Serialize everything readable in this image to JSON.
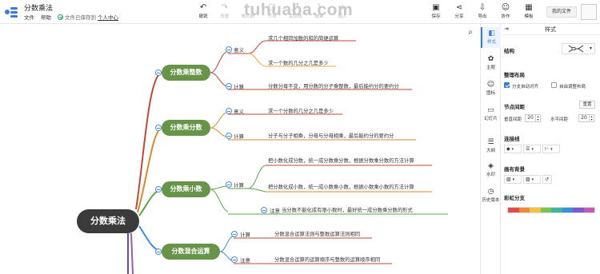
{
  "app": {
    "doc_title": "分数乘法",
    "menu": [
      "文件",
      "帮助"
    ],
    "save_status": "文件已保存到",
    "save_location": "个人中心",
    "watermark": "tuhuaba.com"
  },
  "toolbar": {
    "left": [
      {
        "label": "撤销",
        "icon": "undo-icon",
        "enabled": true
      },
      {
        "label": "恢复",
        "icon": "redo-icon",
        "enabled": false
      },
      {
        "label": "格式刷",
        "icon": "format-brush-icon",
        "enabled": false
      },
      {
        "label": "节点",
        "icon": "node-icon",
        "enabled": false
      },
      {
        "label": "关系线",
        "icon": "relation-line-icon",
        "enabled": false
      },
      {
        "label": "概要",
        "icon": "summary-icon",
        "enabled": false
      },
      {
        "label": "插入",
        "icon": "insert-icon",
        "enabled": false
      }
    ],
    "right": [
      {
        "label": "保存",
        "icon": "save-icon"
      },
      {
        "label": "分享",
        "icon": "share-icon"
      },
      {
        "label": "导出",
        "icon": "export-icon"
      },
      {
        "label": "协作",
        "icon": "collab-icon"
      },
      {
        "label": "模板",
        "icon": "template-icon"
      }
    ],
    "my_files": "我的文件"
  },
  "mindmap": {
    "root": "分数乘法",
    "branches": [
      {
        "label": "分数乘整数",
        "items": [
          {
            "label": "意义",
            "leaves": [
              "求几个相同加数的和的简便运算",
              "求一个数的几分之几是多少"
            ]
          },
          {
            "label": "计算",
            "leaves": [
              "分数分母不变，用分数的分子乘整数，最后能约分的要约分"
            ]
          }
        ]
      },
      {
        "label": "分数乘分数",
        "items": [
          {
            "label": "意义",
            "leaves": [
              "求一个分数的几分之几是多少"
            ]
          },
          {
            "label": "计算",
            "leaves": [
              "分子与分子相乘，分母与分母相乘，最后能约分的要约分"
            ]
          }
        ]
      },
      {
        "label": "分数乘小数",
        "items": [
          {
            "label": "计算",
            "leaves": [
              "把小数化成分数，统一成分数乘分数，根据分数乘分数的方法计算",
              "把分数化成小数，统一成小数乘小数，根据小数乘小数的方法计算"
            ]
          },
          {
            "label": "注意",
            "leaves": [
              "当分数不能化成有限小数时，最好统一成分数乘分数的形式"
            ]
          }
        ]
      },
      {
        "label": "分数混合运算",
        "items": [
          {
            "label": "计算",
            "leaves": [
              "分数混合运算法则与整数运算法则相同"
            ]
          },
          {
            "label": "注意",
            "leaves": [
              "分数混合运算的运算顺序与整数的运算顺序相同"
            ]
          }
        ]
      }
    ]
  },
  "sidebar_tabs": [
    {
      "label": "样式",
      "icon": "style-icon",
      "active": true
    },
    {
      "label": "主题",
      "icon": "theme-icon",
      "active": false
    },
    {
      "label": "图标",
      "icon": "icon-library-icon",
      "active": false
    },
    {
      "label": "幻灯片",
      "icon": "slides-icon",
      "active": false
    },
    {
      "label": "大纲",
      "icon": "outline-icon",
      "active": false
    },
    {
      "label": "水印",
      "icon": "watermark-icon",
      "active": false
    },
    {
      "label": "历史版本",
      "icon": "history-icon",
      "active": false
    }
  ],
  "panel": {
    "title": "样式",
    "structure_label": "结构",
    "layout_label": "整理布局",
    "layout_opt1": "分支自动对齐",
    "layout_opt2": "自由调整布局",
    "layout_opt1_checked": true,
    "layout_opt2_checked": false,
    "spacing_label": "节点间距",
    "reset_label": "重置",
    "vertical_label": "垂直间距",
    "vertical_value": "20",
    "horizontal_label": "水平间距",
    "horizontal_value": "20",
    "connector_label": "连接线",
    "background_label": "画布背景",
    "rainbow_label": "彩虹分支",
    "rainbow_colors": [
      "#e34a4a",
      "#f08a3a",
      "#f3c23d",
      "#7cc24d",
      "#3fb7a0",
      "#3a8fd9",
      "#7a5bd0",
      "#c45bb4"
    ]
  },
  "colors": {
    "branch_fill": "#68944a",
    "root_fill": "#3b3b3b",
    "accent": "#3a7bd5"
  }
}
